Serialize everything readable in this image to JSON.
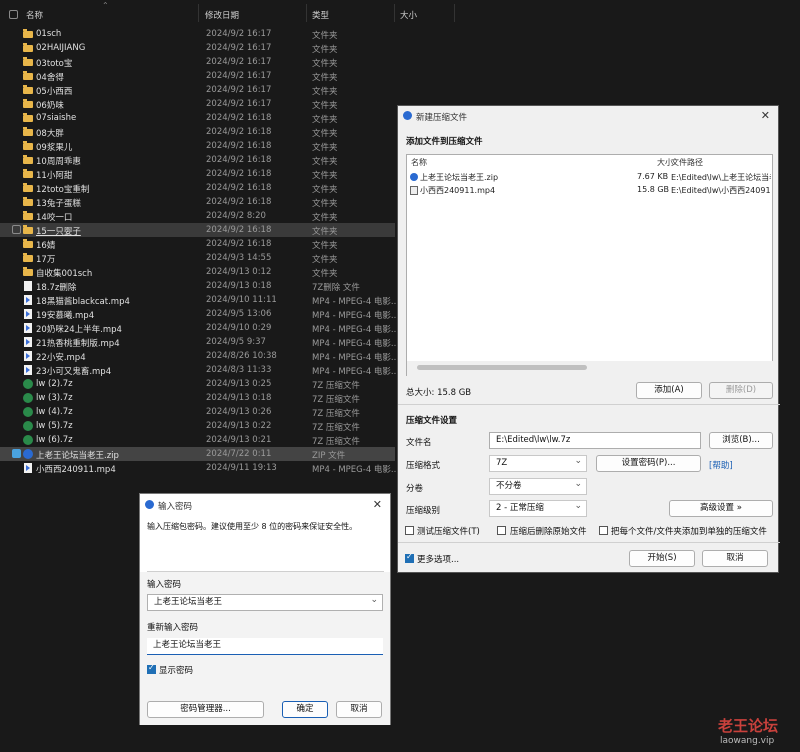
{
  "explorer": {
    "columns": {
      "name": "名称",
      "date": "修改日期",
      "type": "类型",
      "size": "大小"
    },
    "rows": [
      {
        "name": "01sch",
        "date": "2024/9/2 16:17",
        "type": "文件夹",
        "icon": "folder-icon"
      },
      {
        "name": "02HAIJIANG",
        "date": "2024/9/2 16:17",
        "type": "文件夹",
        "icon": "folder-icon"
      },
      {
        "name": "03toto宝",
        "date": "2024/9/2 16:17",
        "type": "文件夹",
        "icon": "folder-icon"
      },
      {
        "name": "04舍得",
        "date": "2024/9/2 16:17",
        "type": "文件夹",
        "icon": "folder-icon"
      },
      {
        "name": "05小西西",
        "date": "2024/9/2 16:17",
        "type": "文件夹",
        "icon": "folder-icon"
      },
      {
        "name": "06奶味",
        "date": "2024/9/2 16:17",
        "type": "文件夹",
        "icon": "folder-icon"
      },
      {
        "name": "07siaishe",
        "date": "2024/9/2 16:18",
        "type": "文件夹",
        "icon": "folder-icon"
      },
      {
        "name": "08大胖",
        "date": "2024/9/2 16:18",
        "type": "文件夹",
        "icon": "folder-icon"
      },
      {
        "name": "09浆果儿",
        "date": "2024/9/2 16:18",
        "type": "文件夹",
        "icon": "folder-icon"
      },
      {
        "name": "10周周乖惠",
        "date": "2024/9/2 16:18",
        "type": "文件夹",
        "icon": "folder-icon"
      },
      {
        "name": "11小阿甜",
        "date": "2024/9/2 16:18",
        "type": "文件夹",
        "icon": "folder-icon"
      },
      {
        "name": "12toto宝重制",
        "date": "2024/9/2 16:18",
        "type": "文件夹",
        "icon": "folder-icon"
      },
      {
        "name": "13兔子蛋糕",
        "date": "2024/9/2 16:18",
        "type": "文件夹",
        "icon": "folder-icon"
      },
      {
        "name": "14咬一口",
        "date": "2024/9/2 8:20",
        "type": "文件夹",
        "icon": "folder-icon"
      },
      {
        "name": "15一只婴子",
        "date": "2024/9/2 16:18",
        "type": "文件夹",
        "icon": "folder-icon"
      },
      {
        "name": "16婧",
        "date": "2024/9/2 16:18",
        "type": "文件夹",
        "icon": "folder-icon"
      },
      {
        "name": "17万",
        "date": "2024/9/3 14:55",
        "type": "文件夹",
        "icon": "folder-icon"
      },
      {
        "name": "自收集001sch",
        "date": "2024/9/13 0:12",
        "type": "文件夹",
        "icon": "folder-icon"
      },
      {
        "name": "18.7z删除",
        "date": "2024/9/13 0:18",
        "type": "7Z删除 文件",
        "icon": "file-icon"
      },
      {
        "name": "18黑猫酱blackcat.mp4",
        "date": "2024/9/10 11:11",
        "type": "MP4 - MPEG-4 电影...",
        "icon": "video-icon"
      },
      {
        "name": "19安慕曦.mp4",
        "date": "2024/9/5 13:06",
        "type": "MP4 - MPEG-4 电影...",
        "icon": "video-icon"
      },
      {
        "name": "20奶咪24上半年.mp4",
        "date": "2024/9/10 0:29",
        "type": "MP4 - MPEG-4 电影...",
        "icon": "video-icon"
      },
      {
        "name": "21热香桃重制版.mp4",
        "date": "2024/9/5 9:37",
        "type": "MP4 - MPEG-4 电影...",
        "icon": "video-icon"
      },
      {
        "name": "22小安.mp4",
        "date": "2024/8/26 10:38",
        "type": "MP4 - MPEG-4 电影...",
        "icon": "video-icon"
      },
      {
        "name": "23小可又鬼畜.mp4",
        "date": "2024/8/3 11:33",
        "type": "MP4 - MPEG-4 电影...",
        "icon": "video-icon"
      },
      {
        "name": "lw (2).7z",
        "date": "2024/9/13 0:25",
        "type": "7Z 压缩文件",
        "icon": "7z-icon"
      },
      {
        "name": "lw (3).7z",
        "date": "2024/9/13 0:18",
        "type": "7Z 压缩文件",
        "icon": "7z-icon"
      },
      {
        "name": "lw (4).7z",
        "date": "2024/9/13 0:26",
        "type": "7Z 压缩文件",
        "icon": "7z-icon"
      },
      {
        "name": "lw (5).7z",
        "date": "2024/9/13 0:22",
        "type": "7Z 压缩文件",
        "icon": "7z-icon"
      },
      {
        "name": "lw (6).7z",
        "date": "2024/9/13 0:21",
        "type": "7Z 压缩文件",
        "icon": "7z-icon"
      },
      {
        "name": "上老王论坛当老王.zip",
        "date": "2024/7/22 0:11",
        "type": "ZIP 文件",
        "icon": "zip-icon"
      },
      {
        "name": "小西西240911.mp4",
        "date": "2024/9/11 19:13",
        "type": "MP4 - MPEG-4 电影...",
        "icon": "video-icon"
      }
    ]
  },
  "compress": {
    "title": "新建压缩文件",
    "add_section": "添加文件到压缩文件",
    "list_headers": {
      "name": "名称",
      "size": "大小",
      "path": "文件路径"
    },
    "files": [
      {
        "name": "上老王论坛当老王.zip",
        "size": "7.67 KB",
        "path": "E:\\Edited\\lw\\上老王论坛当老..."
      },
      {
        "name": "小西西240911.mp4",
        "size": "15.8 GB",
        "path": "E:\\Edited\\lw\\小西西240911..."
      }
    ],
    "total": "总大小: 15.8 GB",
    "add_btn": "添加(A)",
    "remove_btn": "删除(D)",
    "settings_section": "压缩文件设置",
    "filename_label": "文件名",
    "filename_value": "E:\\Edited\\lw\\lw.7z",
    "browse_btn": "浏览(B)...",
    "format_label": "压缩格式",
    "format_value": "7Z",
    "set_password_btn": "设置密码(P)...",
    "help_link": "[帮助]",
    "split_label": "分卷",
    "split_value": "不分卷",
    "level_label": "压缩级别",
    "level_value": "2 - 正常压缩",
    "advanced_btn": "高级设置 »",
    "opt_test": "测试压缩文件(T)",
    "opt_delete": "压缩后删除原始文件",
    "opt_each": "把每个文件/文件夹添加到单独的压缩文件",
    "more_options": "更多选项...",
    "start_btn": "开始(S)",
    "cancel_btn": "取消"
  },
  "password": {
    "title": "输入密码",
    "hint": "输入压缩包密码。建议使用至少 8 位的密码来保证安全性。",
    "label1": "输入密码",
    "value1": "上老王论坛当老王",
    "label2": "重新输入密码",
    "value2": "上老王论坛当老王",
    "show_password": "显示密码",
    "manager_btn": "密码管理器...",
    "ok_btn": "确定",
    "cancel_btn": "取消"
  },
  "watermark": {
    "line1": "老王论坛",
    "line2": "laowang.vip"
  }
}
